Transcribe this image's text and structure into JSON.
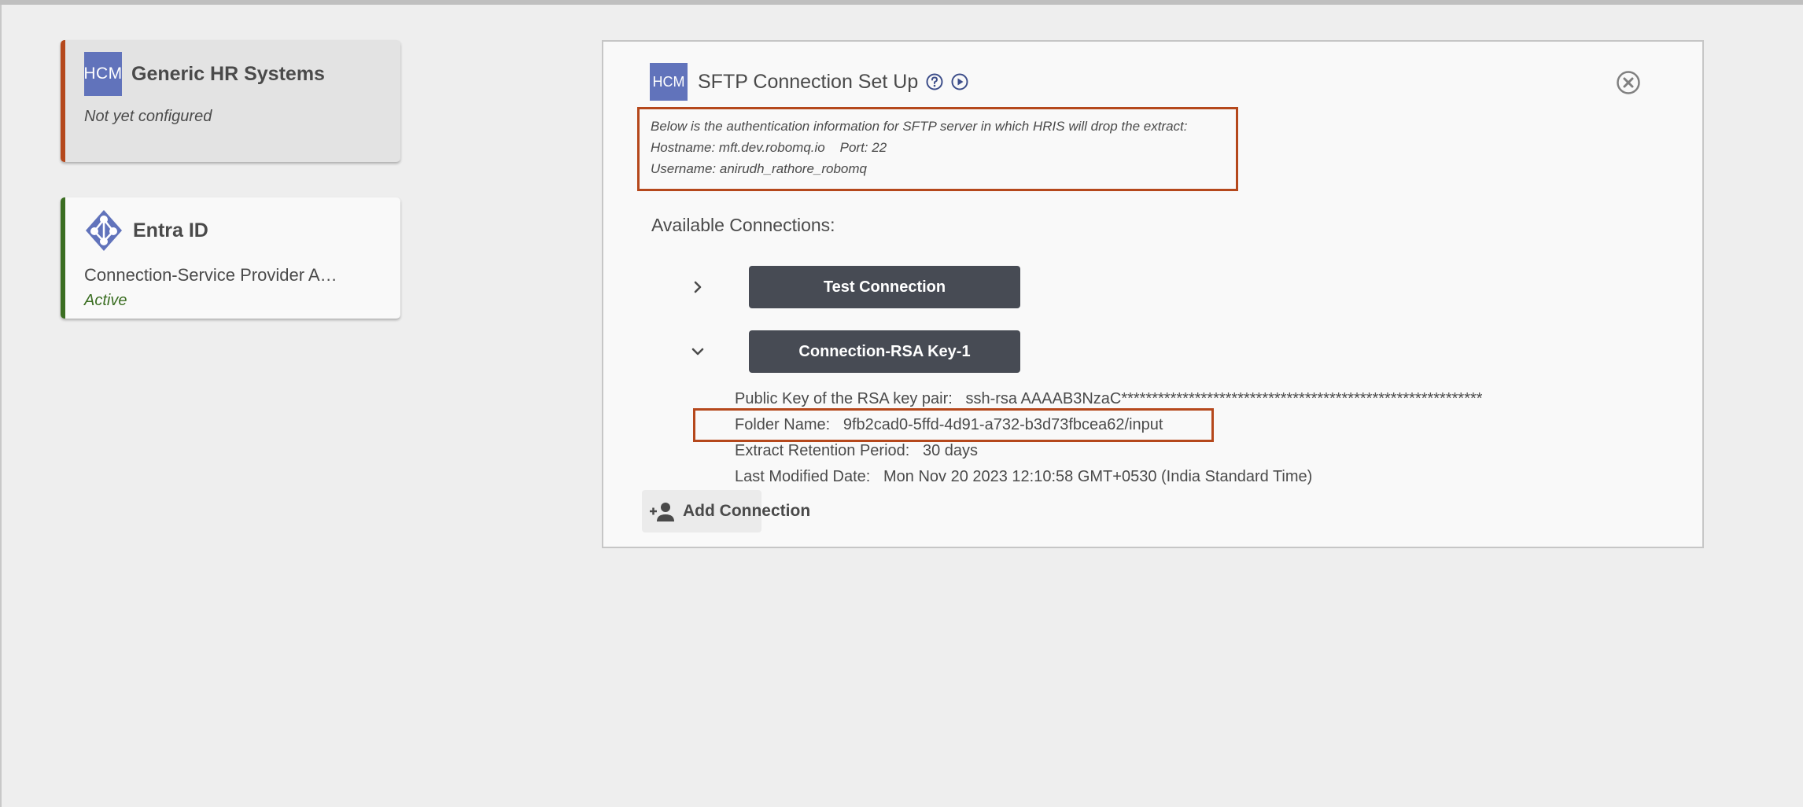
{
  "colors": {
    "accent_orange": "#b5481c",
    "accent_green": "#3b6e22",
    "logo_blue": "#6173bb",
    "button_dark": "#474b54",
    "icon_navy": "#3d4e8a"
  },
  "systems": [
    {
      "logo_text": "HCM",
      "title": "Generic HR Systems",
      "subtitle": "Not yet configured",
      "status": ""
    },
    {
      "logo_icon": "entra-id-icon",
      "title": "Entra ID",
      "subtitle": "Connection-Service Provider A…",
      "status": "Active"
    }
  ],
  "panel": {
    "logo_text": "HCM",
    "title": "SFTP Connection Set Up",
    "icons": [
      "help-circle-icon",
      "play-circle-icon",
      "close-circle-icon"
    ],
    "auth_info": {
      "intro": "Below is the authentication information for SFTP server in which HRIS will drop the extract:",
      "hostname_line": "Hostname: mft.dev.robomq.io    Port: 22",
      "username_line": "Username: anirudh_rathore_robomq"
    },
    "available_label": "Available Connections:",
    "connections": [
      {
        "label": "Test Connection",
        "expanded": false
      },
      {
        "label": "Connection-RSA Key-1",
        "expanded": true
      }
    ],
    "details": {
      "public_key": "Public Key of the RSA key pair:   ssh-rsa AAAAB3NzaC********************************************************************",
      "folder_name": "Folder Name:   9fb2cad0-5ffd-4d91-a732-b3d73fbcea62/input",
      "retention": "Extract Retention Period:   30 days",
      "last_modified": "Last Modified Date:   Mon Nov 20 2023 12:10:58 GMT+0530 (India Standard Time)"
    },
    "add_connection_label": "Add Connection"
  }
}
